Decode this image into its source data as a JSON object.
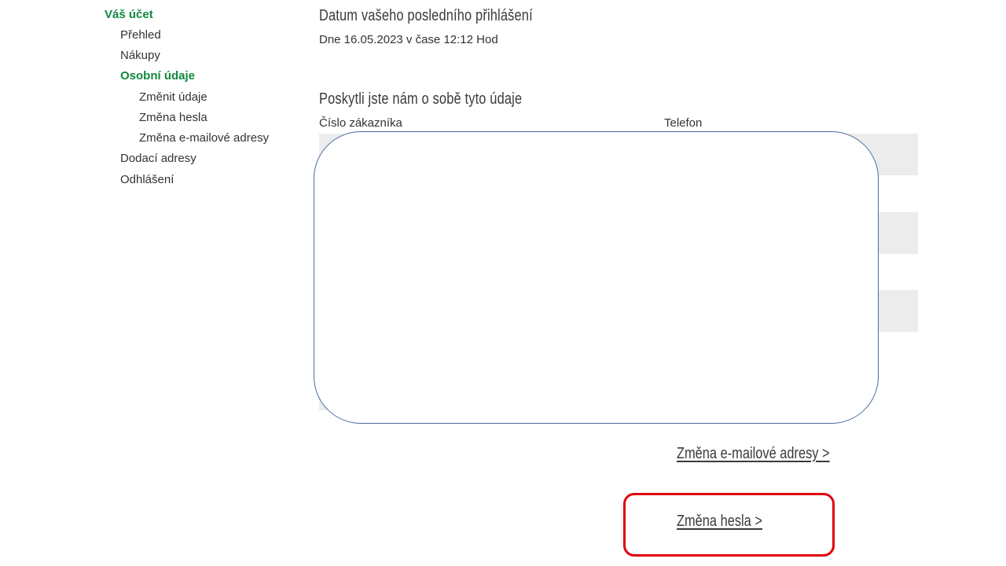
{
  "sidebar": {
    "account_title": "Váš účet",
    "items": [
      {
        "label": "Přehled"
      },
      {
        "label": "Nákupy"
      },
      {
        "label": "Osobní údaje"
      },
      {
        "label": "Změnit údaje"
      },
      {
        "label": "Změna hesla"
      },
      {
        "label": "Změna e-mailové adresy"
      },
      {
        "label": "Dodací adresy"
      },
      {
        "label": "Odhlášení"
      }
    ],
    "active_color": "#10883f"
  },
  "main": {
    "last_login_heading": "Datum vašeho posledního přihlášení",
    "last_login_text": "Dne 16.05.2023 v čase 12:12 Hod",
    "info_heading": "Poskytli jste nám o sobě tyto údaje",
    "columns": {
      "customer_number": "Číslo zákazníka",
      "phone": "Telefon"
    },
    "links": {
      "change_email": "Změna e-mailové adresy >",
      "change_password": "Změna hesla >"
    }
  },
  "colors": {
    "highlight": "#e0000f",
    "overlay_border": "#4a6ea0",
    "row_background": "#ececec"
  }
}
